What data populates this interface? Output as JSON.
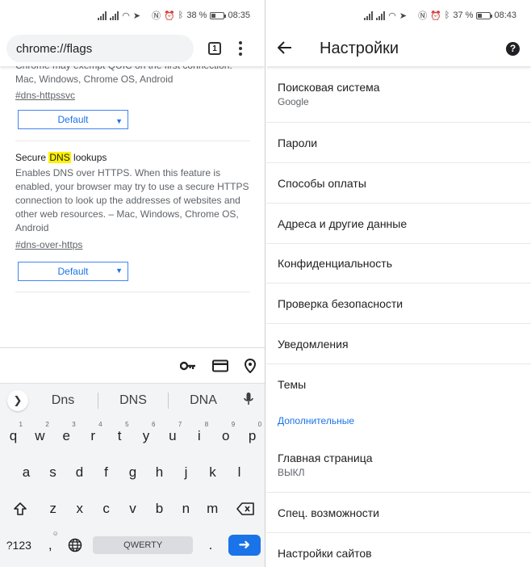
{
  "left": {
    "status": {
      "battery": "38 %",
      "time": "08:35"
    },
    "toolbar": {
      "url": "chrome://flags",
      "tab_count": "1"
    },
    "flag_prev": {
      "desc_cut": "Chrome may exempt QUIC on the first connection. Mac, Windows, Chrome OS, Android",
      "link": "#dns-httpssvc",
      "select": "Default"
    },
    "flag": {
      "title_pre": "Secure ",
      "title_hl": "DNS",
      "title_post": " lookups",
      "desc": "Enables DNS over HTTPS. When this feature is enabled, your browser may try to use a secure HTTPS connection to look up the addresses of websites and other web resources. – Mac, Windows, Chrome OS, Android",
      "link": "#dns-over-https",
      "select": "Default"
    },
    "keyboard": {
      "autofill_icons": [
        "key-icon",
        "credit-card-icon",
        "location-pin-icon"
      ],
      "suggestions": [
        "Dns",
        "DNS",
        "DNA"
      ],
      "row1": [
        {
          "k": "q",
          "n": "1"
        },
        {
          "k": "w",
          "n": "2"
        },
        {
          "k": "e",
          "n": "3"
        },
        {
          "k": "r",
          "n": "4"
        },
        {
          "k": "t",
          "n": "5"
        },
        {
          "k": "y",
          "n": "6"
        },
        {
          "k": "u",
          "n": "7"
        },
        {
          "k": "i",
          "n": "8"
        },
        {
          "k": "o",
          "n": "9"
        },
        {
          "k": "p",
          "n": "0"
        }
      ],
      "row2": [
        "a",
        "s",
        "d",
        "f",
        "g",
        "h",
        "j",
        "k",
        "l"
      ],
      "row3": [
        "z",
        "x",
        "c",
        "v",
        "b",
        "n",
        "m"
      ],
      "sym_key": "?123",
      "comma_key": ",",
      "space_label": "QWERTY",
      "period_key": "."
    }
  },
  "right": {
    "status": {
      "battery": "37 %",
      "time": "08:43"
    },
    "title": "Настройки",
    "items": [
      {
        "title": "Поисковая система",
        "sub": "Google"
      },
      {
        "title": "Пароли"
      },
      {
        "title": "Способы оплаты"
      },
      {
        "title": "Адреса и другие данные"
      },
      {
        "title": "Конфиденциальность"
      },
      {
        "title": "Проверка безопасности"
      },
      {
        "title": "Уведомления"
      },
      {
        "title": "Темы"
      }
    ],
    "section": "Дополнительные",
    "items2": [
      {
        "title": "Главная страница",
        "sub": "ВЫКЛ"
      },
      {
        "title": "Спец. возможности"
      },
      {
        "title": "Настройки сайтов"
      }
    ],
    "accent": "#1a73e8"
  }
}
